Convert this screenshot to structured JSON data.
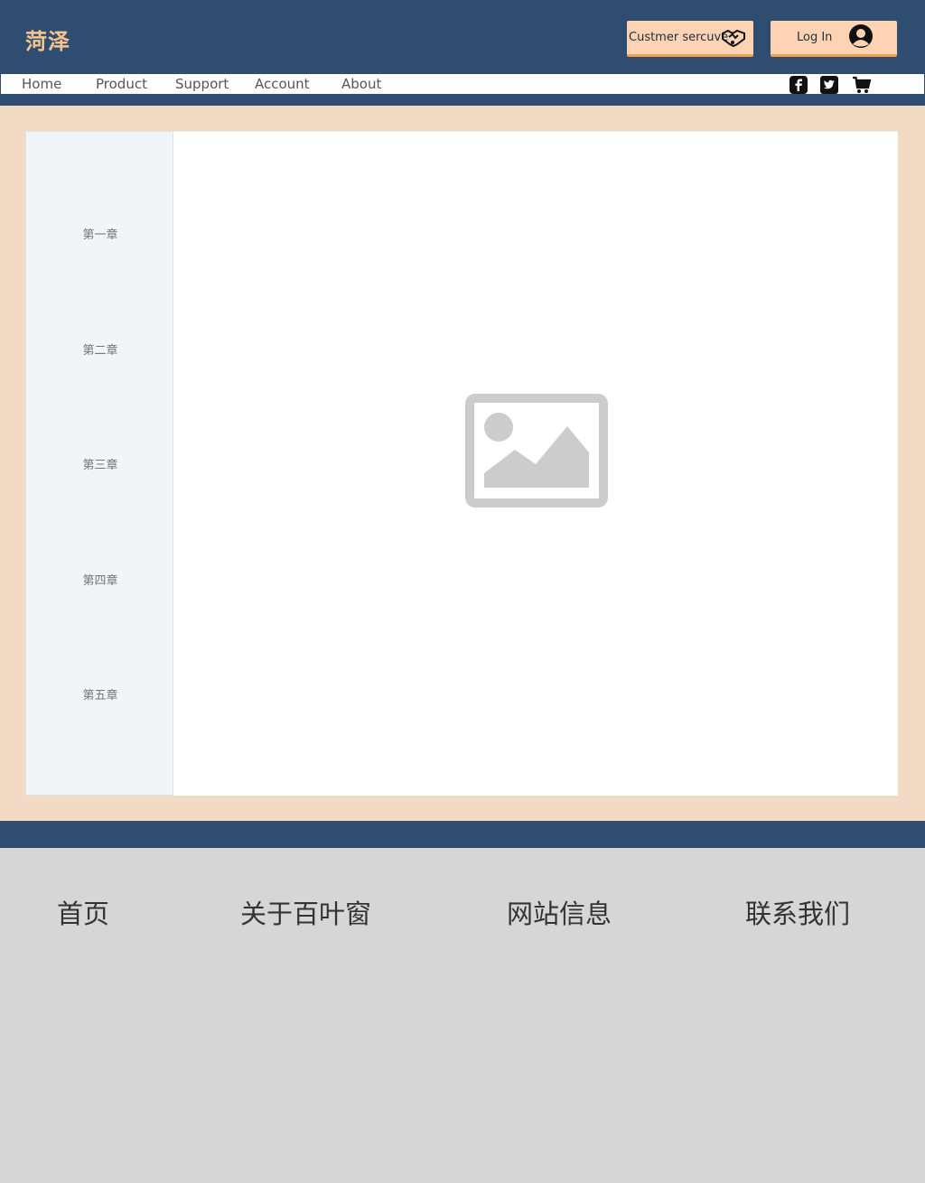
{
  "brand": {
    "logo_text": "菏泽",
    "logo_color": "#f6c48e"
  },
  "header": {
    "customer_service_label": "Custmer sercuve",
    "login_label": "Log In",
    "button_bg": "#fdd3b4",
    "button_border": "#f0a050",
    "bar_color": "#2e4d70"
  },
  "nav": {
    "items": [
      {
        "label": "Home"
      },
      {
        "label": "Product"
      },
      {
        "label": "Support"
      },
      {
        "label": "Account"
      },
      {
        "label": "About"
      }
    ],
    "icons": [
      "facebook-icon",
      "twitter-icon",
      "cart-icon"
    ]
  },
  "sidebar": {
    "chapters": [
      {
        "label": "第一章"
      },
      {
        "label": "第二章"
      },
      {
        "label": "第三章"
      },
      {
        "label": "第四章"
      },
      {
        "label": "第五章"
      }
    ]
  },
  "content": {
    "image": "image-placeholder-icon"
  },
  "footer": {
    "links": [
      {
        "label": "首页"
      },
      {
        "label": "关于百叶窗"
      },
      {
        "label": "网站信息"
      },
      {
        "label": "联系我们"
      }
    ]
  }
}
